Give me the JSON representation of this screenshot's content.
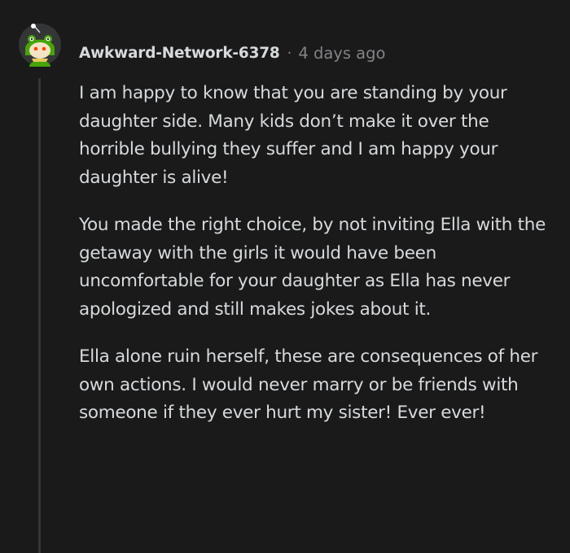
{
  "comment": {
    "author": "Awkward-Network-6378",
    "separator": "·",
    "timestamp": "4 days ago",
    "avatar_icon": "snoo-avatar-icon",
    "paragraphs": [
      "I am happy to know that you are standing by your daughter side. Many kids don’t make it over the horrible bullying they suffer and I am happy your daughter is alive!",
      "You made the right choice, by not inviting Ella with the getaway with the girls it would have been uncomfortable for your daughter as Ella has never apologized and still makes jokes about it.",
      "Ella alone ruin herself, these are consequences of her own actions. I would never marry or be friends with someone if they ever hurt my sister! Ever ever!"
    ]
  },
  "colors": {
    "background": "#1a1a1b",
    "text": "#d7dadc",
    "muted": "#818384",
    "thread_line": "#343536",
    "avatar_green": "#46a508"
  }
}
